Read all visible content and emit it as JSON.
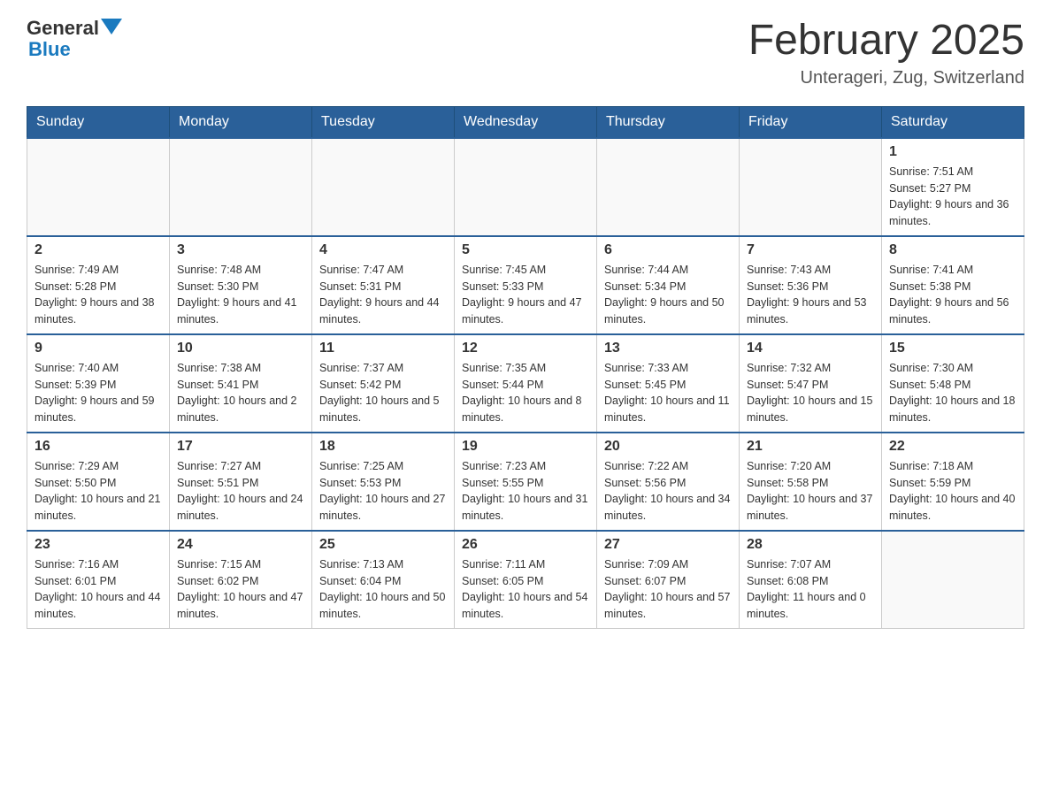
{
  "header": {
    "logo_general": "General",
    "logo_blue": "Blue",
    "month_title": "February 2025",
    "location": "Unterageri, Zug, Switzerland"
  },
  "weekdays": [
    "Sunday",
    "Monday",
    "Tuesday",
    "Wednesday",
    "Thursday",
    "Friday",
    "Saturday"
  ],
  "weeks": [
    {
      "days": [
        {
          "num": "",
          "info": ""
        },
        {
          "num": "",
          "info": ""
        },
        {
          "num": "",
          "info": ""
        },
        {
          "num": "",
          "info": ""
        },
        {
          "num": "",
          "info": ""
        },
        {
          "num": "",
          "info": ""
        },
        {
          "num": "1",
          "info": "Sunrise: 7:51 AM\nSunset: 5:27 PM\nDaylight: 9 hours and 36 minutes."
        }
      ]
    },
    {
      "days": [
        {
          "num": "2",
          "info": "Sunrise: 7:49 AM\nSunset: 5:28 PM\nDaylight: 9 hours and 38 minutes."
        },
        {
          "num": "3",
          "info": "Sunrise: 7:48 AM\nSunset: 5:30 PM\nDaylight: 9 hours and 41 minutes."
        },
        {
          "num": "4",
          "info": "Sunrise: 7:47 AM\nSunset: 5:31 PM\nDaylight: 9 hours and 44 minutes."
        },
        {
          "num": "5",
          "info": "Sunrise: 7:45 AM\nSunset: 5:33 PM\nDaylight: 9 hours and 47 minutes."
        },
        {
          "num": "6",
          "info": "Sunrise: 7:44 AM\nSunset: 5:34 PM\nDaylight: 9 hours and 50 minutes."
        },
        {
          "num": "7",
          "info": "Sunrise: 7:43 AM\nSunset: 5:36 PM\nDaylight: 9 hours and 53 minutes."
        },
        {
          "num": "8",
          "info": "Sunrise: 7:41 AM\nSunset: 5:38 PM\nDaylight: 9 hours and 56 minutes."
        }
      ]
    },
    {
      "days": [
        {
          "num": "9",
          "info": "Sunrise: 7:40 AM\nSunset: 5:39 PM\nDaylight: 9 hours and 59 minutes."
        },
        {
          "num": "10",
          "info": "Sunrise: 7:38 AM\nSunset: 5:41 PM\nDaylight: 10 hours and 2 minutes."
        },
        {
          "num": "11",
          "info": "Sunrise: 7:37 AM\nSunset: 5:42 PM\nDaylight: 10 hours and 5 minutes."
        },
        {
          "num": "12",
          "info": "Sunrise: 7:35 AM\nSunset: 5:44 PM\nDaylight: 10 hours and 8 minutes."
        },
        {
          "num": "13",
          "info": "Sunrise: 7:33 AM\nSunset: 5:45 PM\nDaylight: 10 hours and 11 minutes."
        },
        {
          "num": "14",
          "info": "Sunrise: 7:32 AM\nSunset: 5:47 PM\nDaylight: 10 hours and 15 minutes."
        },
        {
          "num": "15",
          "info": "Sunrise: 7:30 AM\nSunset: 5:48 PM\nDaylight: 10 hours and 18 minutes."
        }
      ]
    },
    {
      "days": [
        {
          "num": "16",
          "info": "Sunrise: 7:29 AM\nSunset: 5:50 PM\nDaylight: 10 hours and 21 minutes."
        },
        {
          "num": "17",
          "info": "Sunrise: 7:27 AM\nSunset: 5:51 PM\nDaylight: 10 hours and 24 minutes."
        },
        {
          "num": "18",
          "info": "Sunrise: 7:25 AM\nSunset: 5:53 PM\nDaylight: 10 hours and 27 minutes."
        },
        {
          "num": "19",
          "info": "Sunrise: 7:23 AM\nSunset: 5:55 PM\nDaylight: 10 hours and 31 minutes."
        },
        {
          "num": "20",
          "info": "Sunrise: 7:22 AM\nSunset: 5:56 PM\nDaylight: 10 hours and 34 minutes."
        },
        {
          "num": "21",
          "info": "Sunrise: 7:20 AM\nSunset: 5:58 PM\nDaylight: 10 hours and 37 minutes."
        },
        {
          "num": "22",
          "info": "Sunrise: 7:18 AM\nSunset: 5:59 PM\nDaylight: 10 hours and 40 minutes."
        }
      ]
    },
    {
      "days": [
        {
          "num": "23",
          "info": "Sunrise: 7:16 AM\nSunset: 6:01 PM\nDaylight: 10 hours and 44 minutes."
        },
        {
          "num": "24",
          "info": "Sunrise: 7:15 AM\nSunset: 6:02 PM\nDaylight: 10 hours and 47 minutes."
        },
        {
          "num": "25",
          "info": "Sunrise: 7:13 AM\nSunset: 6:04 PM\nDaylight: 10 hours and 50 minutes."
        },
        {
          "num": "26",
          "info": "Sunrise: 7:11 AM\nSunset: 6:05 PM\nDaylight: 10 hours and 54 minutes."
        },
        {
          "num": "27",
          "info": "Sunrise: 7:09 AM\nSunset: 6:07 PM\nDaylight: 10 hours and 57 minutes."
        },
        {
          "num": "28",
          "info": "Sunrise: 7:07 AM\nSunset: 6:08 PM\nDaylight: 11 hours and 0 minutes."
        },
        {
          "num": "",
          "info": ""
        }
      ]
    }
  ]
}
